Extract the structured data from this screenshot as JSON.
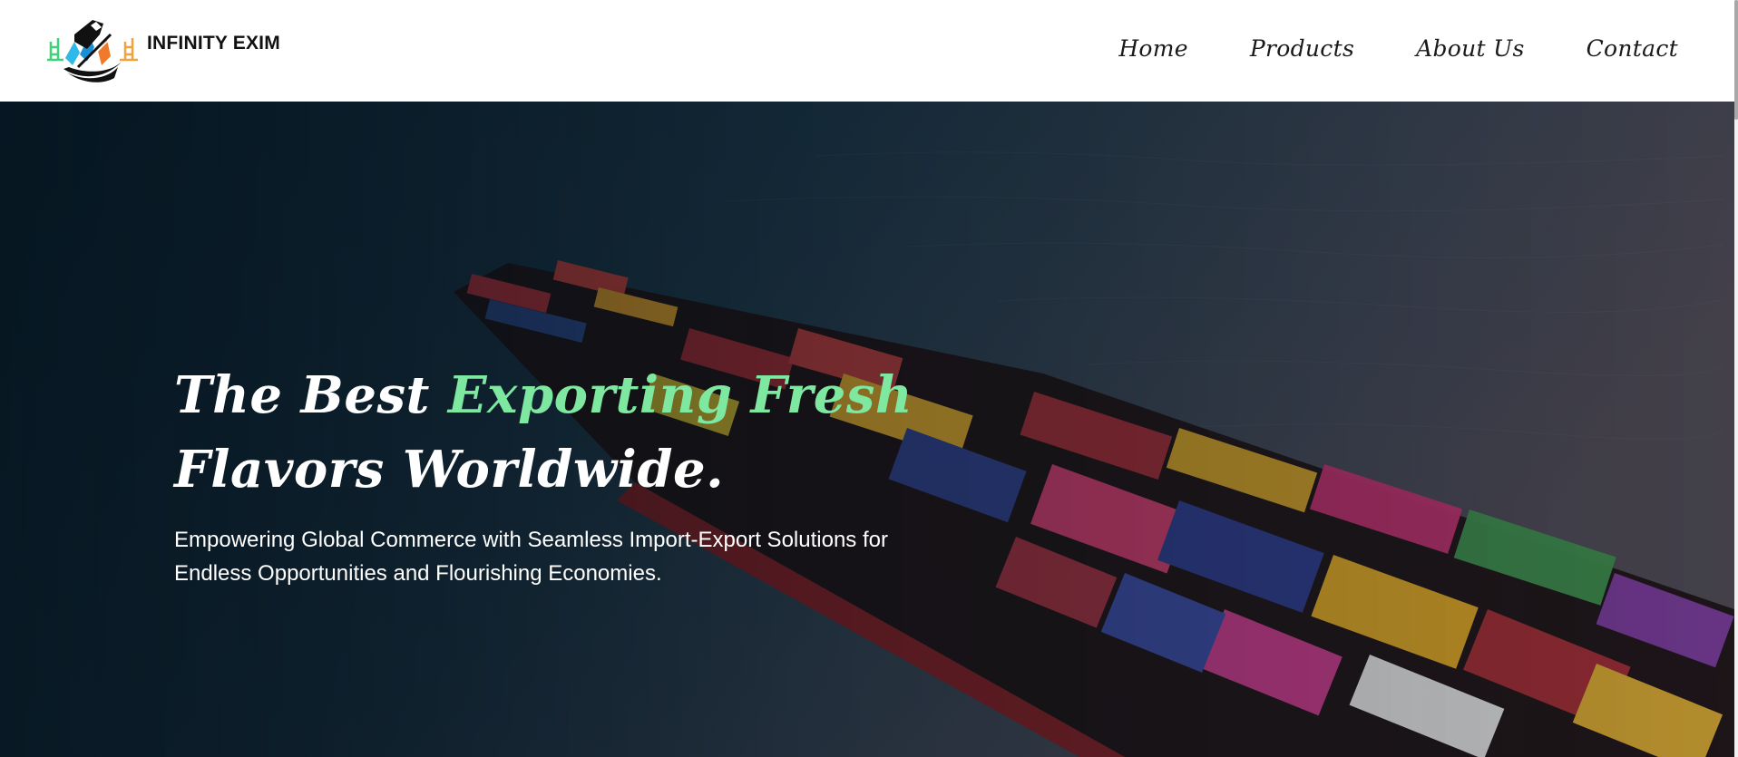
{
  "brand": {
    "name": "INFINITY EXIM",
    "logo_icon": "ship-globe-logo"
  },
  "nav": {
    "items": [
      "Home",
      "Products",
      "About Us",
      "Contact"
    ]
  },
  "hero": {
    "title_part1": "The Best ",
    "title_accent": "Exporting Fresh",
    "title_part2": "Flavors Worldwide.",
    "subtitle_line1": "Empowering Global Commerce with Seamless Import-Export Solutions for",
    "subtitle_line2": "Endless Opportunities and Flourishing Economies.",
    "background_icon": "container-ship-photo"
  },
  "colors": {
    "accent": "#7ee7a0",
    "header_bg": "#ffffff",
    "hero_overlay": "#0b2232",
    "text_light": "#ffffff",
    "text_dark": "#1a1a1a"
  }
}
